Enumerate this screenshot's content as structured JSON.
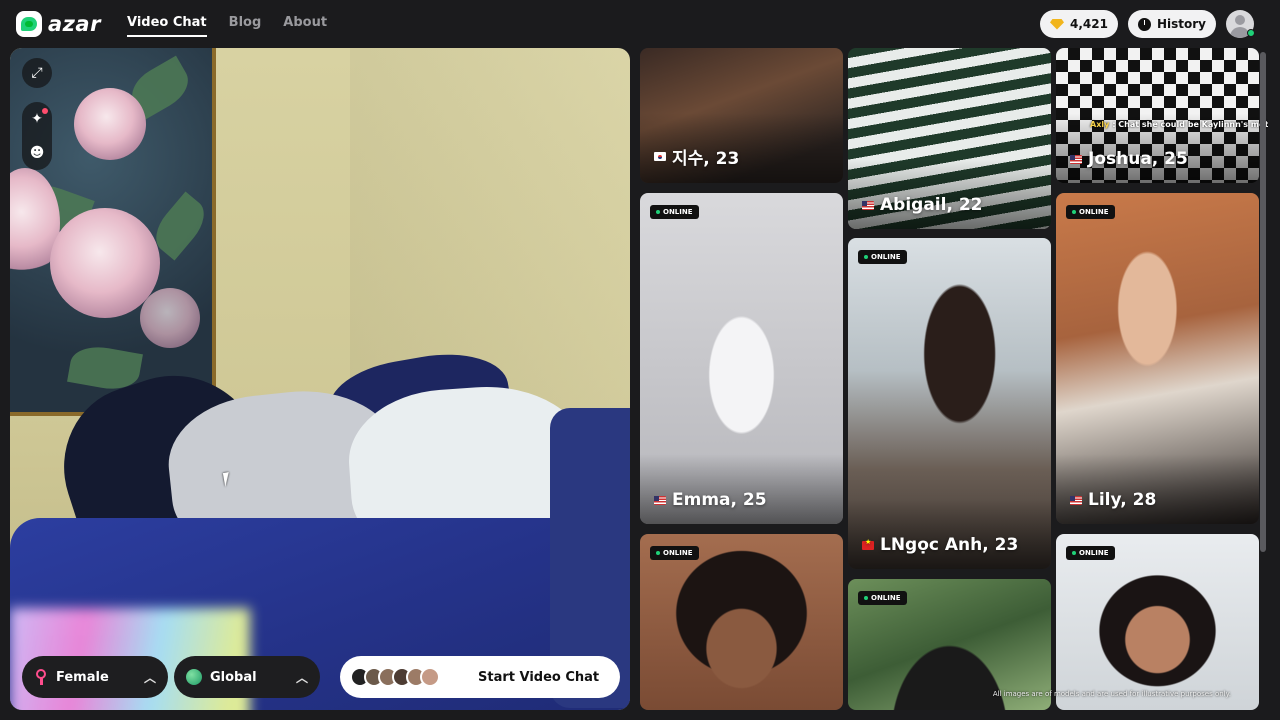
{
  "brand": {
    "name": "azar"
  },
  "nav": {
    "items": [
      {
        "label": "Video Chat",
        "active": true
      },
      {
        "label": "Blog",
        "active": false
      },
      {
        "label": "About",
        "active": false
      }
    ]
  },
  "header": {
    "gems": "4,421",
    "history_label": "History"
  },
  "camera": {
    "tools": [
      "expand-icon",
      "sparkle-effects-icon",
      "sticker-icon"
    ]
  },
  "controls": {
    "gender": {
      "label": "Female"
    },
    "region": {
      "label": "Global"
    },
    "start": {
      "label": "Start Video Chat"
    }
  },
  "gallery": {
    "online_label": "ONLINE",
    "cards": [
      {
        "name": "지수, 23",
        "flag": "kr",
        "online": false
      },
      {
        "name": "Abigail, 22",
        "flag": "us",
        "online": false
      },
      {
        "name": "Joshua, 25",
        "flag": "us",
        "online": false
      },
      {
        "name": "Emma, 25",
        "flag": "us",
        "online": true
      },
      {
        "name": "LNgọc Anh, 23",
        "flag": "vn",
        "online": true
      },
      {
        "name": "Lily, 28",
        "flag": "us",
        "online": true
      },
      {
        "name": "",
        "flag": "",
        "online": true
      },
      {
        "name": "",
        "flag": "",
        "online": true
      },
      {
        "name": "",
        "flag": "",
        "online": true
      }
    ],
    "chat_overlay": {
      "user": "Axly",
      "message": ": Chat she could be Kaylinnn's mother"
    },
    "disclaimer": "All images are of models and are used for illustrative purposes only."
  },
  "colors": {
    "accent": "#1fd178",
    "female": "#ff4d8d",
    "gem": "#f1b51c"
  }
}
